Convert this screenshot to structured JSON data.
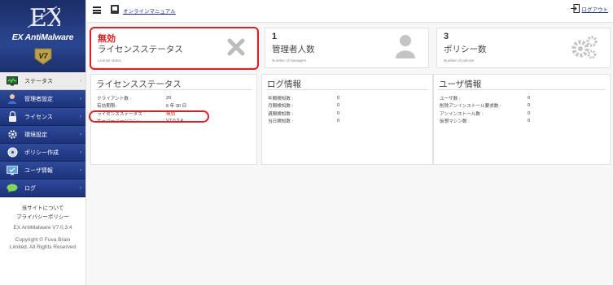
{
  "sidebar": {
    "logo_text": "EX AntiMalware",
    "logo_mark": "EX",
    "logo_badge": "V7",
    "items": [
      {
        "label": "ステータス",
        "icon": "monitor-icon",
        "active": true
      },
      {
        "label": "管理者設定",
        "icon": "user-icon",
        "active": false
      },
      {
        "label": "ライセンス",
        "icon": "lock-icon",
        "active": false
      },
      {
        "label": "環境設定",
        "icon": "gear-icon",
        "active": false
      },
      {
        "label": "ポリシー作成",
        "icon": "disc-icon",
        "active": false
      },
      {
        "label": "ユーザ情報",
        "icon": "screen-check-icon",
        "active": false
      },
      {
        "label": "ログ",
        "icon": "chat-bubble-icon",
        "active": false
      }
    ],
    "footer": {
      "about": "当サイトについて",
      "privacy": "プライバシーポリシー",
      "version": "EX AntiMalware V7 0.3.4",
      "copyright": "Copyright © Fuva Brain Limited. All Rights Reserved"
    }
  },
  "topbar": {
    "manual": "オンラインマニュアル",
    "logout": "ログアウト"
  },
  "stats": [
    {
      "value": "無効",
      "label": "ライセンスステータス",
      "sub": "License status",
      "icon": "x-mark-icon",
      "alert": true
    },
    {
      "value": "1",
      "label": "管理者人数",
      "sub": "Number of managers",
      "icon": "person-icon",
      "alert": false
    },
    {
      "value": "3",
      "label": "ポリシー数",
      "sub": "Number of policies",
      "icon": "gears-icon",
      "alert": false
    }
  ],
  "license_panel": {
    "title": "ライセンスステータス",
    "rows": [
      {
        "k": "クライアント数 :",
        "v": "20"
      },
      {
        "k": "有効期限 :",
        "v": "6 年 30 日"
      },
      {
        "k": "ライセンスステータス :",
        "v": "無効"
      },
      {
        "k": "サーバーバージョン :",
        "v": "V7 0.3.4"
      }
    ]
  },
  "log_panel": {
    "title": "ログ情報",
    "rows": [
      {
        "k": "年間検知数 :",
        "v": "0"
      },
      {
        "k": "月間検知数 :",
        "v": "0"
      },
      {
        "k": "週間検知数 :",
        "v": "0"
      },
      {
        "k": "当日検知数 :",
        "v": "0"
      }
    ]
  },
  "user_panel": {
    "title": "ユーザ情報",
    "rows": [
      {
        "k": "ユーザ数 :",
        "v": "0"
      },
      {
        "k": "削除アンインストール要求数 :",
        "v": "0"
      },
      {
        "k": "アンインストール数 :",
        "v": "0"
      },
      {
        "k": "仮想マシン数 :",
        "v": "0"
      }
    ]
  },
  "colors": {
    "nav_bg": "#1d3279",
    "alert": "#e02020",
    "link": "#1d3279"
  }
}
